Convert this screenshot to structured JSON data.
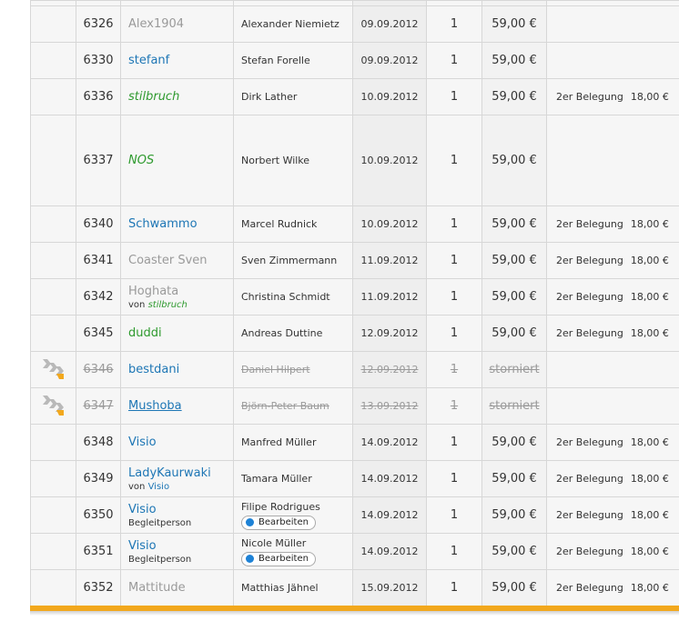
{
  "rows": [
    {
      "id": "6326",
      "user": "Alex1904",
      "user_style": "gray",
      "name": "Alexander Niemietz",
      "date": "09.09.2012",
      "qty": "1",
      "price": "59,00 €",
      "extra_label": "",
      "extra_price": ""
    },
    {
      "id": "6330",
      "user": "stefanf",
      "user_style": "blue",
      "name": "Stefan Forelle",
      "date": "09.09.2012",
      "qty": "1",
      "price": "59,00 €",
      "extra_label": "",
      "extra_price": ""
    },
    {
      "id": "6336",
      "user": "stilbruch",
      "user_style": "green-i",
      "name": "Dirk Lather",
      "date": "10.09.2012",
      "qty": "1",
      "price": "59,00 €",
      "extra_label": "2er Belegung",
      "extra_price": "18,00 €"
    },
    {
      "id": "6337",
      "user": "NOS",
      "user_style": "green-i",
      "name": "Norbert Wilke",
      "date": "10.09.2012",
      "qty": "1",
      "price": "59,00 €",
      "extra_label": "",
      "extra_price": ""
    },
    {
      "id": "6340",
      "user": "Schwammo",
      "user_style": "blue",
      "name": "Marcel Rudnick",
      "date": "10.09.2012",
      "qty": "1",
      "price": "59,00 €",
      "extra_label": "2er Belegung",
      "extra_price": "18,00 €"
    },
    {
      "id": "6341",
      "user": "Coaster Sven",
      "user_style": "gray",
      "name": "Sven Zimmermann",
      "date": "11.09.2012",
      "qty": "1",
      "price": "59,00 €",
      "extra_label": "2er Belegung",
      "extra_price": "18,00 €"
    },
    {
      "id": "6342",
      "user": "Hoghata",
      "user_style": "gray",
      "sub_prefix": "von",
      "sub_link": "stilbruch",
      "name": "Christina Schmidt",
      "date": "11.09.2012",
      "qty": "1",
      "price": "59,00 €",
      "extra_label": "2er Belegung",
      "extra_price": "18,00 €"
    },
    {
      "id": "6345",
      "user": "duddi",
      "user_style": "green",
      "name": "Andreas Duttine",
      "date": "12.09.2012",
      "qty": "1",
      "price": "59,00 €",
      "extra_label": "2er Belegung",
      "extra_price": "18,00 €"
    },
    {
      "id": "6346",
      "user": "bestdani",
      "user_style": "blue",
      "name": "Daniel Hilpert",
      "date": "12.09.2012",
      "qty": "1",
      "price": "storniert",
      "extra_label": "",
      "extra_price": ""
    },
    {
      "id": "6347",
      "user": "Mushoba",
      "user_style": "blue",
      "name": "Björn-Peter Baum",
      "date": "13.09.2012",
      "qty": "1",
      "price": "storniert",
      "extra_label": "",
      "extra_price": ""
    },
    {
      "id": "6348",
      "user": "Visio",
      "user_style": "blue",
      "name": "Manfred Müller",
      "date": "14.09.2012",
      "qty": "1",
      "price": "59,00 €",
      "extra_label": "2er Belegung",
      "extra_price": "18,00 €"
    },
    {
      "id": "6349",
      "user": "LadyKaurwaki",
      "user_style": "blue",
      "sub_prefix": "von",
      "sub_link": "Visio",
      "name": "Tamara Müller",
      "date": "14.09.2012",
      "qty": "1",
      "price": "59,00 €",
      "extra_label": "2er Belegung",
      "extra_price": "18,00 €"
    },
    {
      "id": "6350",
      "user": "Visio",
      "user_style": "blue",
      "sub_text": "Begleitperson",
      "name": "Filipe Rodrigues",
      "edit_label": "Bearbeiten",
      "date": "14.09.2012",
      "qty": "1",
      "price": "59,00 €",
      "extra_label": "2er Belegung",
      "extra_price": "18,00 €"
    },
    {
      "id": "6351",
      "user": "Visio",
      "user_style": "blue",
      "sub_text": "Begleitperson",
      "name": "Nicole Müller",
      "edit_label": "Bearbeiten",
      "date": "14.09.2012",
      "qty": "1",
      "price": "59,00 €",
      "extra_label": "2er Belegung",
      "extra_price": "18,00 €"
    },
    {
      "id": "6352",
      "user": "Mattitude",
      "user_style": "gray",
      "name": "Matthias Jähnel",
      "date": "15.09.2012",
      "qty": "1",
      "price": "59,00 €",
      "extra_label": "2er Belegung",
      "extra_price": "18,00 €"
    }
  ],
  "colors": {
    "accent_bar": "#f2a81d",
    "link_blue": "#1d76b5",
    "link_green": "#2e9a2e",
    "muted_gray": "#9a9a9a"
  },
  "icons": {
    "cancelled_row": "double-chevron-icon"
  }
}
